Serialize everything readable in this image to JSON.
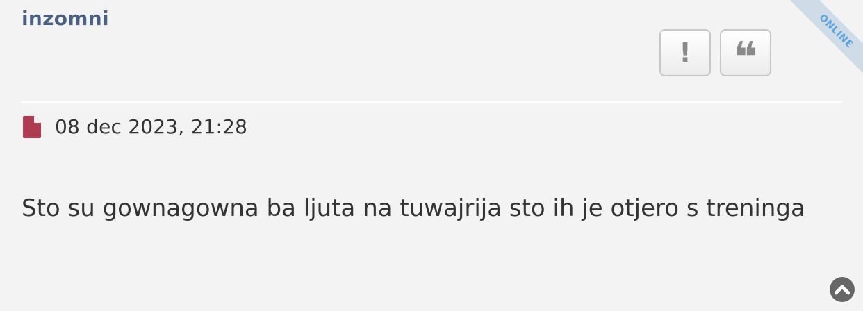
{
  "post": {
    "author": "inzomni",
    "status_ribbon": "ONLINE",
    "date": "08 dec 2023, 21:28",
    "content": "Sto su gownagowna ba ljuta na tuwajrija sto ih je otjero s treninga"
  },
  "actions": {
    "report_label": "!",
    "quote_label": "❝"
  },
  "colors": {
    "author": "#4a6080",
    "background": "#f3f3f3",
    "post_icon": "#b03a4f",
    "ribbon_bg": "#cfdbe6",
    "ribbon_text": "#5da6df"
  },
  "icons": {
    "post_icon": "file-icon",
    "scroll": "chevron-up-icon"
  }
}
